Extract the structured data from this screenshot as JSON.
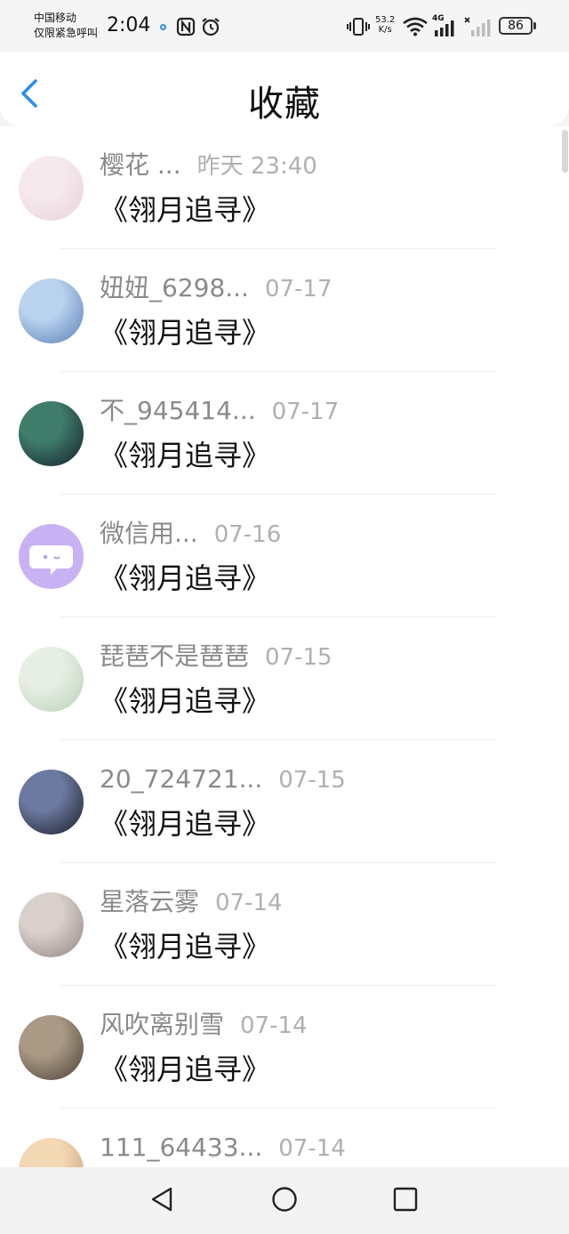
{
  "status_bar": {
    "carrier_line1": "中国移动",
    "carrier_line2": "仅限紧急呼叫",
    "time": "2:04",
    "net_speed_value": "53.2",
    "net_speed_unit": "K/s",
    "network_type": "4G",
    "battery": "86",
    "icons": [
      "nfc-icon",
      "alarm-icon",
      "vibrate-icon",
      "wifi-icon",
      "signal-icon",
      "no-signal-icon",
      "battery-icon"
    ]
  },
  "header": {
    "title": "收藏",
    "back_icon": "chevron-left-icon",
    "accent_color": "#2a8df0"
  },
  "items": [
    {
      "user": "樱花 ...",
      "time": "昨天 23:40",
      "title": "《翎月追寻》",
      "avatar_colors": [
        "#f6e9ee",
        "#e8d2dc"
      ]
    },
    {
      "user": "妞妞_6298...",
      "time": "07-17",
      "title": "《翎月追寻》",
      "avatar_colors": [
        "#b9d3ef",
        "#5b7db3"
      ]
    },
    {
      "user": "不_945414...",
      "time": "07-17",
      "title": "《翎月追寻》",
      "avatar_colors": [
        "#3f7c6a",
        "#141d2c"
      ]
    },
    {
      "user": "微信用...",
      "time": "07-16",
      "title": "《翎月追寻》",
      "avatar_colors": [
        "#d4c0f5",
        "#b79bec"
      ]
    },
    {
      "user": "琵琶不是琶琶",
      "time": "07-15",
      "title": "《翎月追寻》",
      "avatar_colors": [
        "#e7eee4",
        "#b9d2b8"
      ]
    },
    {
      "user": "20_724721...",
      "time": "07-15",
      "title": "《翎月追寻》",
      "avatar_colors": [
        "#6c7aa1",
        "#1b1d25"
      ]
    },
    {
      "user": "星落云雾",
      "time": "07-14",
      "title": "《翎月追寻》",
      "avatar_colors": [
        "#d9cfcb",
        "#8f8482"
      ]
    },
    {
      "user": "风吹离别雪",
      "time": "07-14",
      "title": "《翎月追寻》",
      "avatar_colors": [
        "#a99985",
        "#4b3f35"
      ]
    },
    {
      "user": "111_64433...",
      "time": "07-14",
      "title": "《翎月追寻》",
      "avatar_colors": [
        "#f3d8b4",
        "#c99a78"
      ]
    }
  ],
  "nav": {
    "back_icon": "triangle-back-icon",
    "home_icon": "circle-home-icon",
    "recents_icon": "square-recents-icon"
  }
}
